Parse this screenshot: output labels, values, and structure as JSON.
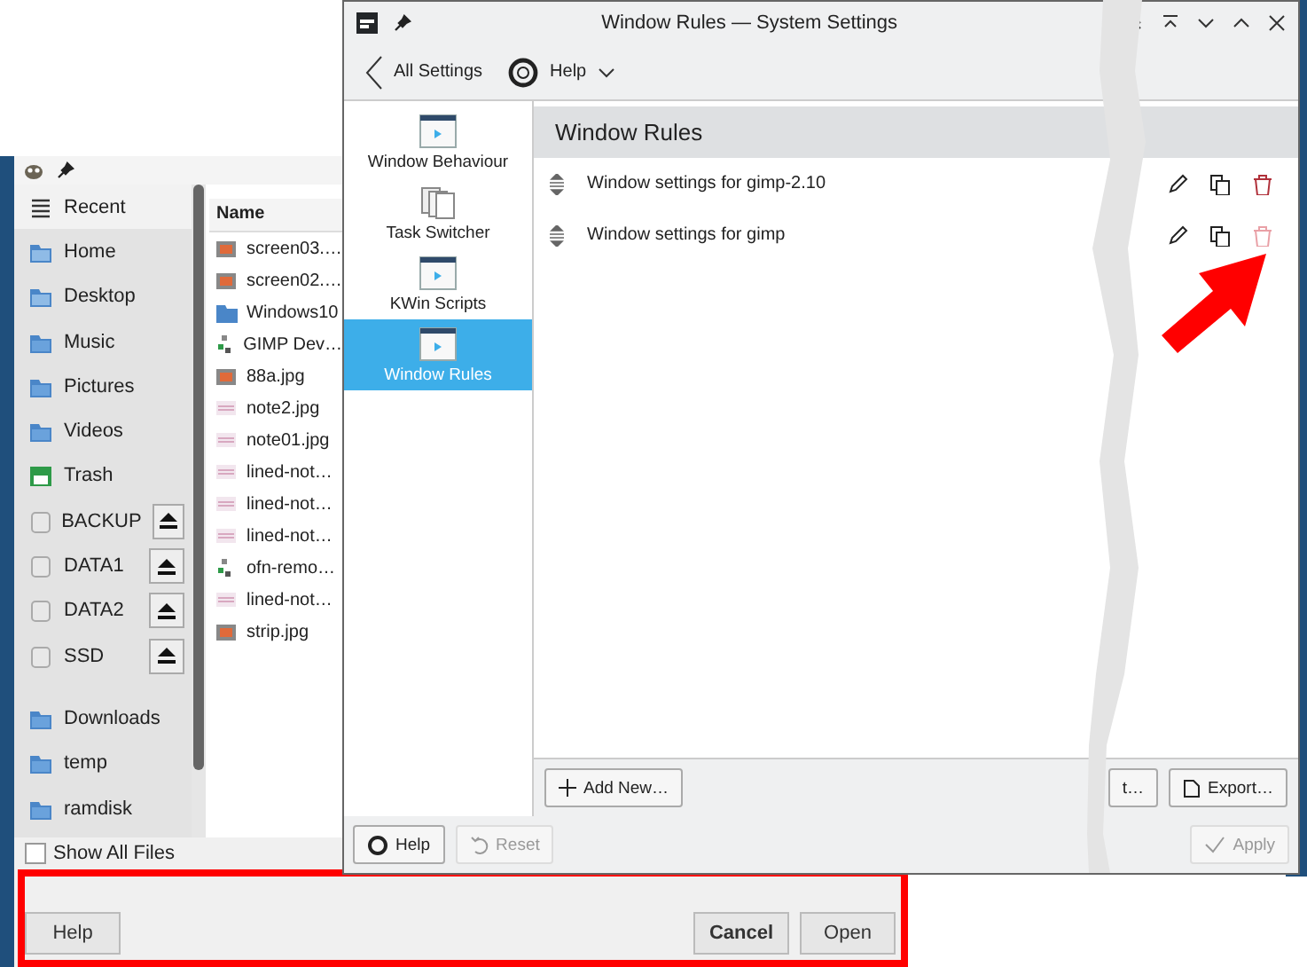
{
  "file_dialog": {
    "places": [
      {
        "label": "Recent",
        "kind": "recent",
        "selected": true,
        "eject": false
      },
      {
        "label": "Home",
        "kind": "home",
        "selected": false,
        "eject": false
      },
      {
        "label": "Desktop",
        "kind": "desktop",
        "selected": false,
        "eject": false
      },
      {
        "label": "Music",
        "kind": "folder",
        "selected": false,
        "eject": false
      },
      {
        "label": "Pictures",
        "kind": "folder",
        "selected": false,
        "eject": false
      },
      {
        "label": "Videos",
        "kind": "folder",
        "selected": false,
        "eject": false
      },
      {
        "label": "Trash",
        "kind": "trash",
        "selected": false,
        "eject": false
      },
      {
        "label": "BACKUP",
        "kind": "drive",
        "selected": false,
        "eject": true
      },
      {
        "label": "DATA1",
        "kind": "drive",
        "selected": false,
        "eject": true
      },
      {
        "label": "DATA2",
        "kind": "drive",
        "selected": false,
        "eject": true
      },
      {
        "label": "SSD",
        "kind": "drive",
        "selected": false,
        "eject": true
      }
    ],
    "bookmarks": [
      {
        "label": "Downloads",
        "kind": "folder",
        "selected": false,
        "eject": false
      },
      {
        "label": "temp",
        "kind": "folder",
        "selected": false,
        "eject": false
      },
      {
        "label": "ramdisk",
        "kind": "folder",
        "selected": false,
        "eject": false
      }
    ],
    "column": "Name",
    "files": [
      {
        "name": "screen03.…",
        "kind": "image"
      },
      {
        "name": "screen02.…",
        "kind": "image"
      },
      {
        "name": "Windows10",
        "kind": "folder"
      },
      {
        "name": "GIMP Dev…",
        "kind": "doc"
      },
      {
        "name": "88a.jpg",
        "kind": "image"
      },
      {
        "name": "note2.jpg",
        "kind": "note"
      },
      {
        "name": "note01.jpg",
        "kind": "note"
      },
      {
        "name": "lined-not…",
        "kind": "note"
      },
      {
        "name": "lined-not…",
        "kind": "note"
      },
      {
        "name": "lined-not…",
        "kind": "note"
      },
      {
        "name": "ofn-remo…",
        "kind": "doc"
      },
      {
        "name": "lined-not…",
        "kind": "note"
      },
      {
        "name": "strip.jpg",
        "kind": "image"
      }
    ],
    "show_all_files": {
      "label": "Show All Files",
      "checked": false
    },
    "help_button": "Help",
    "buttons": [
      {
        "label": "Cancel",
        "default": true
      },
      {
        "label": "Open",
        "default": false
      }
    ]
  },
  "settings": {
    "title": "Window Rules — System Settings",
    "back": "All Settings",
    "help": "Help",
    "sidebar": [
      {
        "label": "Window Behaviour",
        "kind": "window",
        "selected": false
      },
      {
        "label": "Task Switcher",
        "kind": "stack",
        "selected": false
      },
      {
        "label": "KWin Scripts",
        "kind": "window",
        "selected": false
      },
      {
        "label": "Window Rules",
        "kind": "window",
        "selected": true
      }
    ],
    "page_title": "Window Rules",
    "rules": [
      {
        "name": "Window settings for gimp-2.10",
        "delete_enabled": true
      },
      {
        "name": "Window settings for gimp",
        "delete_enabled": false
      }
    ],
    "footer_buttons": [
      {
        "label": "Add New…",
        "kind": "plus"
      },
      {
        "label": "t…",
        "kind": "plain"
      },
      {
        "label": "Export…",
        "kind": "export"
      }
    ],
    "bottom_buttons": [
      {
        "label": "Help",
        "kind": "help",
        "disabled": false
      },
      {
        "label": "Reset",
        "kind": "reset",
        "disabled": true
      }
    ],
    "apply": {
      "label": "Apply",
      "disabled": true
    }
  }
}
